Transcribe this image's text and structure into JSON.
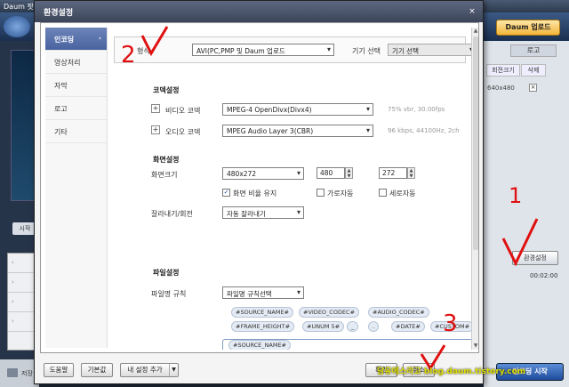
{
  "app": {
    "title": "Daum 팟",
    "daum_upload": "Daum 업로드",
    "tab_logo": "로고",
    "col_rotate": "회전크기",
    "col_delete": "삭제",
    "resolution_value": "640x480",
    "remove_x": "×",
    "env_button": "환경설정",
    "time_label": "00:02:00",
    "play_label": "시작",
    "encode_button": "인코딩 시작",
    "bottom_label": "저장"
  },
  "dialog": {
    "title": "환경설정",
    "close": "×",
    "nav": [
      {
        "label": "인코딩",
        "active": true
      },
      {
        "label": "영상처리",
        "active": false
      },
      {
        "label": "자막",
        "active": false
      },
      {
        "label": "로고",
        "active": false
      },
      {
        "label": "기타",
        "active": false
      }
    ],
    "format": {
      "label": "형식",
      "value": "AVI(PC,PMP 및 Daum 업로드",
      "device_label": "기기 선택",
      "device_value": "기기 선택"
    },
    "codec_section": "코덱설정",
    "video_codec": {
      "label": "비디오 코덱",
      "value": "MPEG-4 OpenDivx(Divx4)",
      "hint": "75% vbr, 30.00fps"
    },
    "audio_codec": {
      "label": "오디오 코덱",
      "value": "MPEG Audio Layer 3(CBR)",
      "hint": "96 kbps, 44100Hz, 2ch"
    },
    "screen_section": "화면설정",
    "screen_size": {
      "label": "화면크기",
      "value": "480x272",
      "width": "480",
      "height": "272"
    },
    "checkboxes": [
      {
        "label": "화면 비율 유지",
        "checked": true
      },
      {
        "label": "가로자동",
        "checked": false
      },
      {
        "label": "세로자동",
        "checked": false
      }
    ],
    "crop": {
      "label": "잘라내기/회전",
      "value": "자동 잘라내기"
    },
    "file_section": "파일설정",
    "filename_rule": {
      "label": "파일명 규칙",
      "select": "파일명 규칙선택"
    },
    "tags_row1": [
      "#SOURCE_NAME#",
      "#VIDEO_CODEC#",
      "#AUDIO_CODEC#"
    ],
    "tags_row2": [
      "#FRAME_HEIGHT#",
      "#UNUM 5#",
      "_",
      ".",
      "#DATE#",
      "#CUSTOM#"
    ],
    "filename_value": "#SOURCE_NAME#",
    "buttons": {
      "help": "도움말",
      "default": "기본값",
      "add_setting": "내 설정 추가",
      "ok": "확인",
      "cancel": "취소"
    }
  },
  "annotations": {
    "n1": "1",
    "n2": "2",
    "n3": "3",
    "watermark": "담유에스라고 blog.daum.tistory.com"
  },
  "colors": {
    "nav_active": "#4a63a0",
    "annotation_red": "#e01010",
    "watermark": "#e0e000"
  }
}
